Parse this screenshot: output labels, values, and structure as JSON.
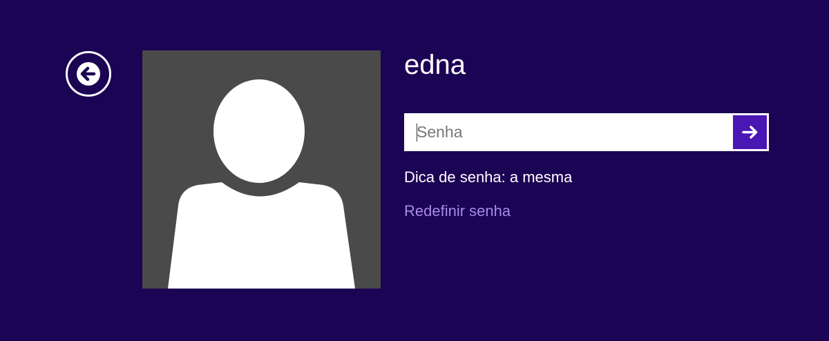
{
  "colors": {
    "background": "#1b0454",
    "avatar_background": "#4a4a4a",
    "submit_button": "#4a17b4",
    "link": "#a98ae8",
    "text": "#ffffff"
  },
  "back": {
    "icon": "arrow-left-circle-icon"
  },
  "user": {
    "name": "edna",
    "avatar_icon": "user-silhouette-icon"
  },
  "password": {
    "value": "",
    "placeholder": "Senha",
    "submit_icon": "arrow-right-icon"
  },
  "hint": {
    "text": "Dica de senha: a mesma"
  },
  "reset": {
    "label": "Redefinir senha"
  }
}
